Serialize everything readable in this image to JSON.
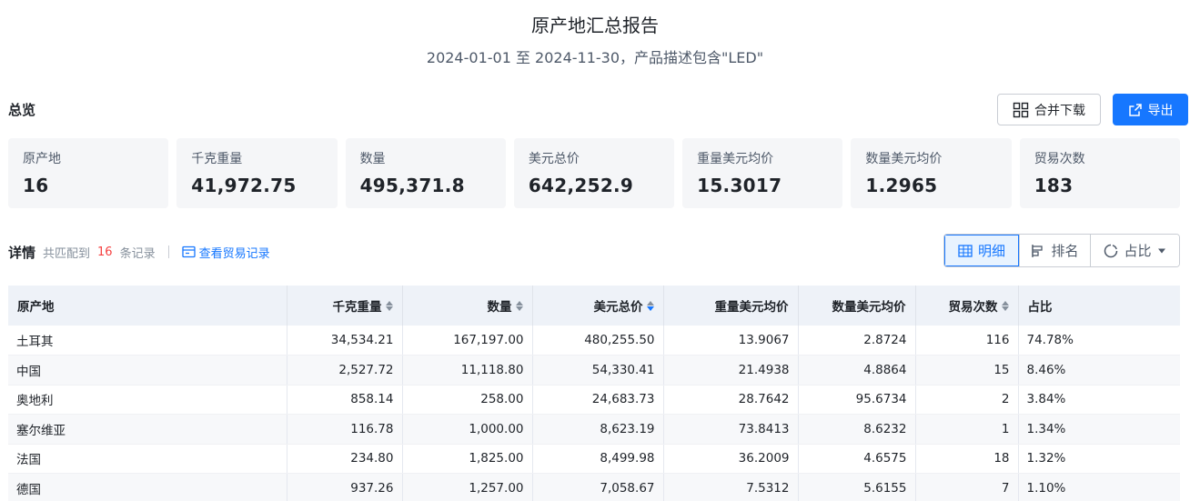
{
  "report": {
    "title": "原产地汇总报告",
    "subtitle": "2024-01-01 至 2024-11-30，产品描述包含\"LED\""
  },
  "overview": {
    "label": "总览",
    "merge_download_label": "合并下载",
    "export_label": "导出",
    "cards": [
      {
        "label": "原产地",
        "value": "16"
      },
      {
        "label": "千克重量",
        "value": "41,972.75"
      },
      {
        "label": "数量",
        "value": "495,371.8"
      },
      {
        "label": "美元总价",
        "value": "642,252.9"
      },
      {
        "label": "重量美元均价",
        "value": "15.3017"
      },
      {
        "label": "数量美元均价",
        "value": "1.2965"
      },
      {
        "label": "贸易次数",
        "value": "183"
      }
    ]
  },
  "detail": {
    "label": "详情",
    "matched_prefix": "共匹配到",
    "matched_count": "16",
    "matched_suffix": "条记录",
    "view_trade_label": "查看贸易记录",
    "view_tabs": {
      "detail": "明细",
      "rank": "排名",
      "share": "占比"
    }
  },
  "table": {
    "headers": [
      "原产地",
      "千克重量",
      "数量",
      "美元总价",
      "重量美元均价",
      "数量美元均价",
      "贸易次数",
      "占比"
    ],
    "rows": [
      [
        "土耳其",
        "34,534.21",
        "167,197.00",
        "480,255.50",
        "13.9067",
        "2.8724",
        "116",
        "74.78%"
      ],
      [
        "中国",
        "2,527.72",
        "11,118.80",
        "54,330.41",
        "21.4938",
        "4.8864",
        "15",
        "8.46%"
      ],
      [
        "奥地利",
        "858.14",
        "258.00",
        "24,683.73",
        "28.7642",
        "95.6734",
        "2",
        "3.84%"
      ],
      [
        "塞尔维亚",
        "116.78",
        "1,000.00",
        "8,623.19",
        "73.8413",
        "8.6232",
        "1",
        "1.34%"
      ],
      [
        "法国",
        "234.80",
        "1,825.00",
        "8,499.98",
        "36.2009",
        "4.6575",
        "18",
        "1.32%"
      ],
      [
        "德国",
        "937.26",
        "1,257.00",
        "7,058.67",
        "7.5312",
        "5.6155",
        "7",
        "1.10%"
      ]
    ]
  },
  "colors": {
    "accent": "#1677ff",
    "count_red": "#f53f3f",
    "header_bg": "#eef2f8"
  }
}
